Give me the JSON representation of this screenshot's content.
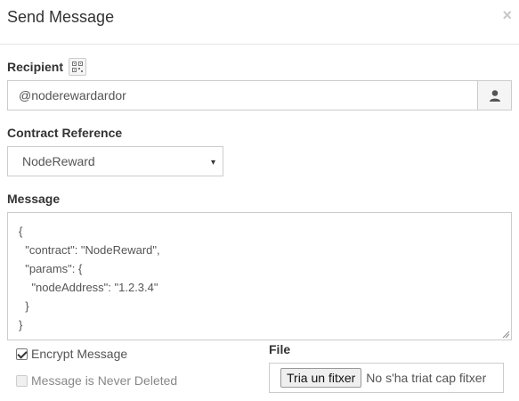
{
  "modal": {
    "title": "Send Message",
    "close_label": "×"
  },
  "recipient": {
    "label": "Recipient",
    "value": "@noderewardardor",
    "qr_icon": "qr-code-icon",
    "contact_icon": "user-icon"
  },
  "contract_reference": {
    "label": "Contract Reference",
    "selected": "NodeReward",
    "arrow": "▾"
  },
  "message": {
    "label": "Message",
    "value": "{\n  \"contract\": \"NodeReward\",\n  \"params\": {\n    \"nodeAddress\": \"1.2.3.4\"\n  }\n}"
  },
  "options": {
    "encrypt_label": "Encrypt Message",
    "encrypt_checked": true,
    "never_deleted_label": "Message is Never Deleted",
    "never_deleted_checked": false
  },
  "file": {
    "label": "File",
    "button_label": "Tria un fitxer",
    "status": "No s'ha triat cap fitxer"
  }
}
